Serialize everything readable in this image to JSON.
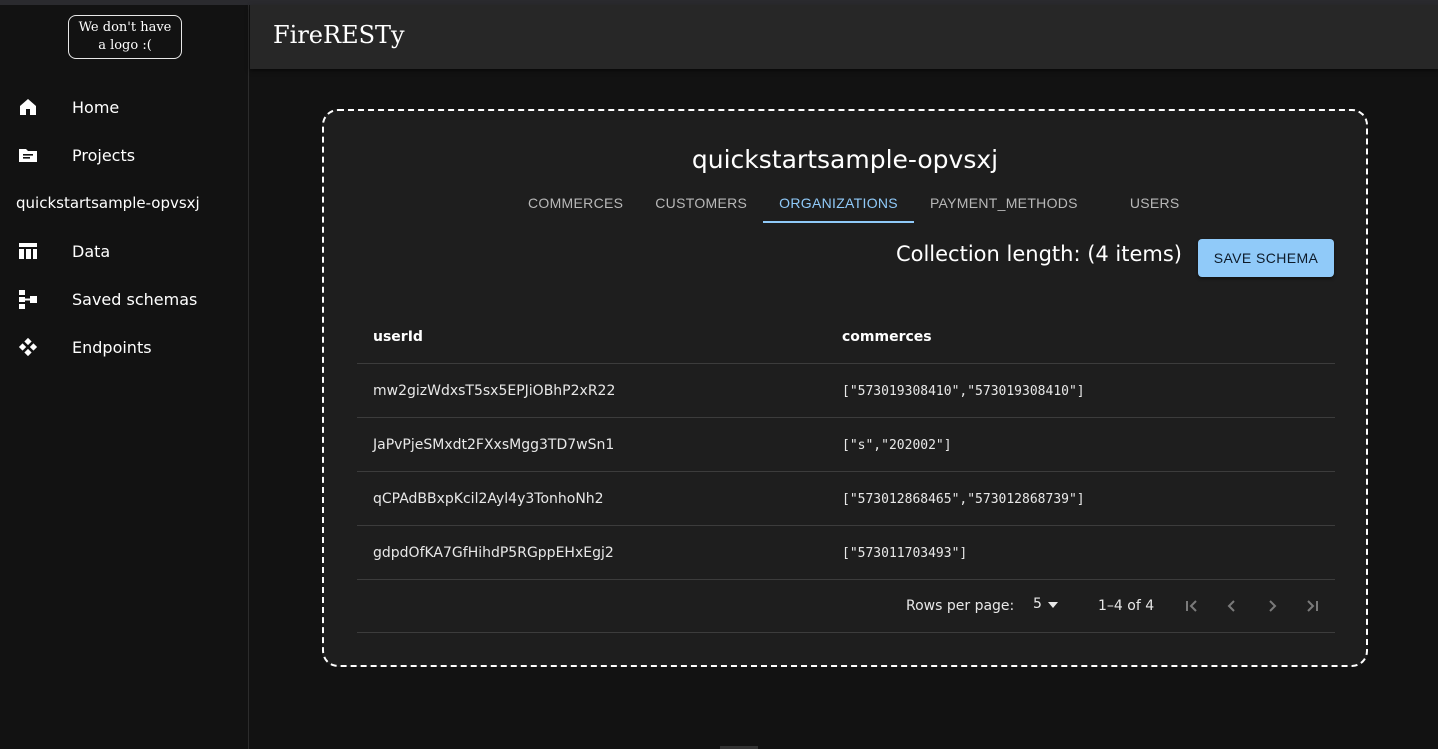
{
  "logo": {
    "line1": "We don't have",
    "line2": "a logo :("
  },
  "header": {
    "title": "FireRESTy"
  },
  "sidebar": {
    "items": [
      {
        "label": "Home",
        "icon": "home-icon"
      },
      {
        "label": "Projects",
        "icon": "folder-icon"
      },
      {
        "label": "quickstartsample-opvsxj",
        "icon": ""
      },
      {
        "label": "Data",
        "icon": "table-icon"
      },
      {
        "label": "Saved schemas",
        "icon": "schema-icon"
      },
      {
        "label": "Endpoints",
        "icon": "endpoints-icon"
      }
    ]
  },
  "main": {
    "project_title": "quickstartsample-opvsxj",
    "tabs": [
      {
        "label": "COMMERCES",
        "active": false
      },
      {
        "label": "CUSTOMERS",
        "active": false
      },
      {
        "label": "ORGANIZATIONS",
        "active": true
      },
      {
        "label": "PAYMENT_METHODS",
        "active": false
      },
      {
        "label": "USERS",
        "active": false
      }
    ],
    "collection_length": "Collection length: (4 items)",
    "save_button": "SAVE SCHEMA",
    "table": {
      "headers": [
        "userId",
        "commerces"
      ],
      "rows": [
        [
          "mw2gizWdxsT5sx5EPJiOBhP2xR22",
          "[\"573019308410\",\"573019308410\"]"
        ],
        [
          "JaPvPjeSMxdt2FXxsMgg3TD7wSn1",
          "[\"s\",\"202002\"]"
        ],
        [
          "qCPAdBBxpKcil2Ayl4y3TonhoNh2",
          "[\"573012868465\",\"573012868739\"]"
        ],
        [
          "gdpdOfKA7GfHihdP5RGppEHxEgj2",
          "[\"573011703493\"]"
        ]
      ]
    },
    "pagination": {
      "rows_per_page_label": "Rows per page:",
      "rows_per_page_value": "5",
      "range": "1–4 of 4"
    }
  },
  "colors": {
    "accent": "#90caf9",
    "background": "#121212",
    "surface": "#1e1e1e",
    "header": "#272727"
  }
}
